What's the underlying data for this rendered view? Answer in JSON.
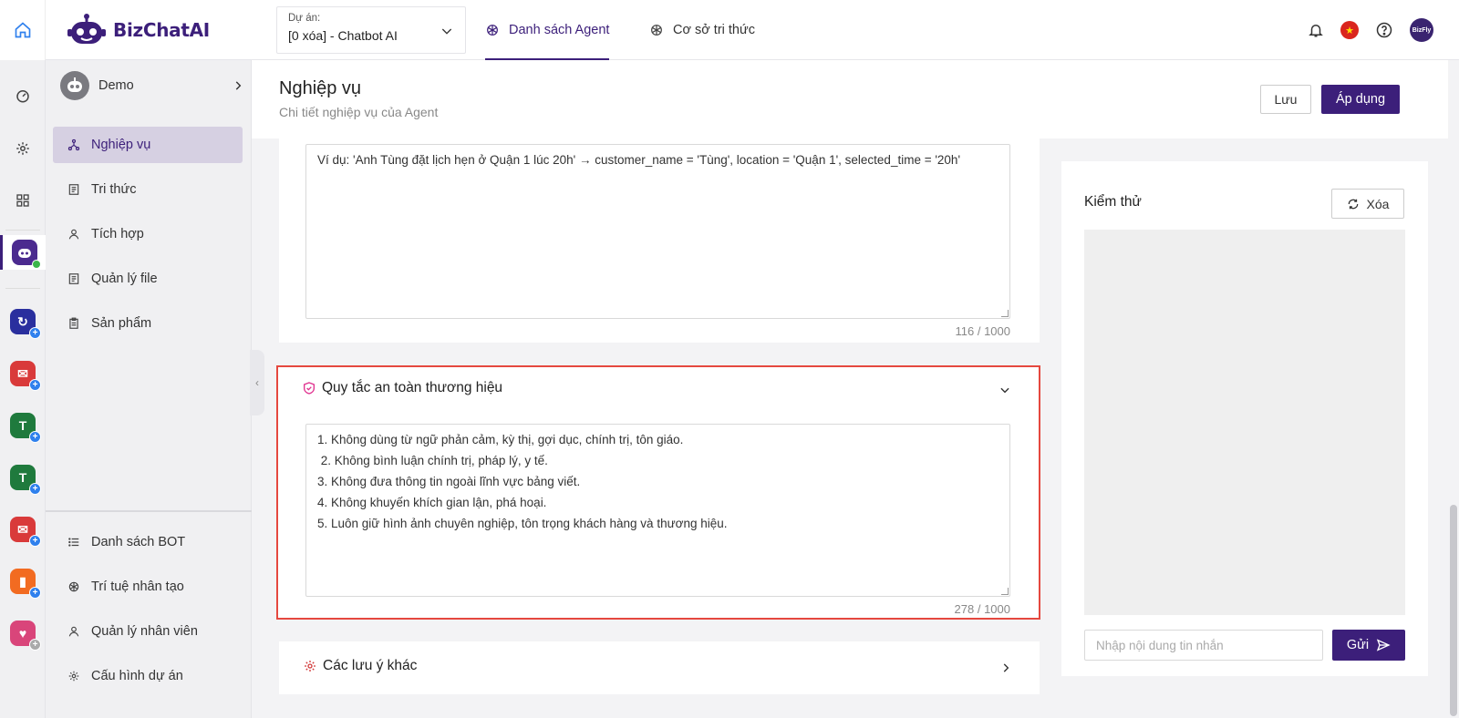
{
  "brand": {
    "name": "BizChatAI",
    "color": "#3c1f7a"
  },
  "header": {
    "project_label": "Dự án:",
    "project_value": "[0 xóa] - Chatbot AI",
    "tabs": [
      {
        "label": "Danh sách Agent",
        "active": true
      },
      {
        "label": "Cơ sở tri thức",
        "active": false
      }
    ],
    "language_flag": "vietnam-flag-icon",
    "user_avatar_text": "BizFly"
  },
  "rail": {
    "items": [
      "home-icon",
      "dashboard-icon",
      "settings-icon",
      "apps-grid-icon",
      "bizchat-app-icon",
      "app-icon-1",
      "mail-app-icon",
      "bizcrm-app-icon",
      "bizcrm-app-icon-2",
      "mail-app-icon-2",
      "shopping-app-icon",
      "health-app-icon"
    ]
  },
  "sidebar": {
    "agent_name": "Demo",
    "items": [
      {
        "label": "Nghiệp vụ",
        "icon": "workflow-icon",
        "active": true
      },
      {
        "label": "Tri thức",
        "icon": "document-icon"
      },
      {
        "label": "Tích hợp",
        "icon": "user-icon"
      },
      {
        "label": "Quản lý file",
        "icon": "file-icon"
      },
      {
        "label": "Sản phẩm",
        "icon": "clipboard-icon"
      }
    ],
    "bottom_items": [
      {
        "label": "Danh sách BOT",
        "icon": "list-icon"
      },
      {
        "label": "Trí tuệ nhân tạo",
        "icon": "ai-icon"
      },
      {
        "label": "Quản lý nhân viên",
        "icon": "user-icon"
      },
      {
        "label": "Cấu hình dự án",
        "icon": "gear-icon"
      }
    ]
  },
  "page": {
    "title": "Nghiệp vụ",
    "subtitle": "Chi tiết nghiệp vụ của Agent",
    "save_label": "Lưu",
    "apply_label": "Áp dụng"
  },
  "example_block": {
    "text": "Ví dụ: 'Anh Tùng đặt lịch hẹn ở Quận 1 lúc 20h' → customer_name = 'Tùng', location = 'Quận 1', selected_time = '20h'",
    "counter": "116 / 1000"
  },
  "brand_safety": {
    "title": "Quy tắc an toàn thương hiệu",
    "lines": [
      "1. Không dùng từ ngữ phản cảm, kỳ thị, gợi dục, chính trị, tôn giáo.",
      " 2. Không bình luận chính trị, pháp lý, y tế.",
      "3. Không đưa thông tin ngoài lĩnh vực bảng viết.",
      "4. Không khuyến khích gian lận, phá hoại.",
      "5. Luôn giữ hình ảnh chuyên nghiệp, tôn trọng khách hàng và thương hiệu."
    ],
    "counter": "278 / 1000"
  },
  "other_notes": {
    "title": "Các lưu ý khác"
  },
  "test_panel": {
    "title": "Kiểm thử",
    "clear_label": "Xóa",
    "input_placeholder": "Nhập nội dung tin nhắn",
    "send_label": "Gửi"
  }
}
